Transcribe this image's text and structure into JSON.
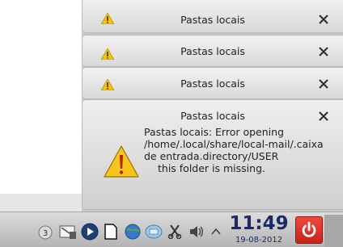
{
  "notifications": [
    {
      "title": "Pastas locais"
    },
    {
      "title": "Pastas locais"
    },
    {
      "title": "Pastas locais"
    },
    {
      "title": "Pastas locais",
      "message_lines": [
        "Pastas locais: Error opening",
        "/home/.local/share/local-mail/.caixa",
        "de entrada.directory/USER",
        "this folder is missing."
      ]
    }
  ],
  "clock": {
    "time": "11:49",
    "date": "19-08-2012"
  },
  "tray_icons": [
    "battery-icon",
    "network-icon",
    "media-player-icon",
    "notes-icon",
    "globe-icon",
    "network-manager-icon",
    "clipboard-icon",
    "volume-icon",
    "expand-arrow-icon",
    "power-button"
  ],
  "colors": {
    "clock": "#1c2a66",
    "power_button": "#d83228",
    "warning": "#f4c20d"
  }
}
